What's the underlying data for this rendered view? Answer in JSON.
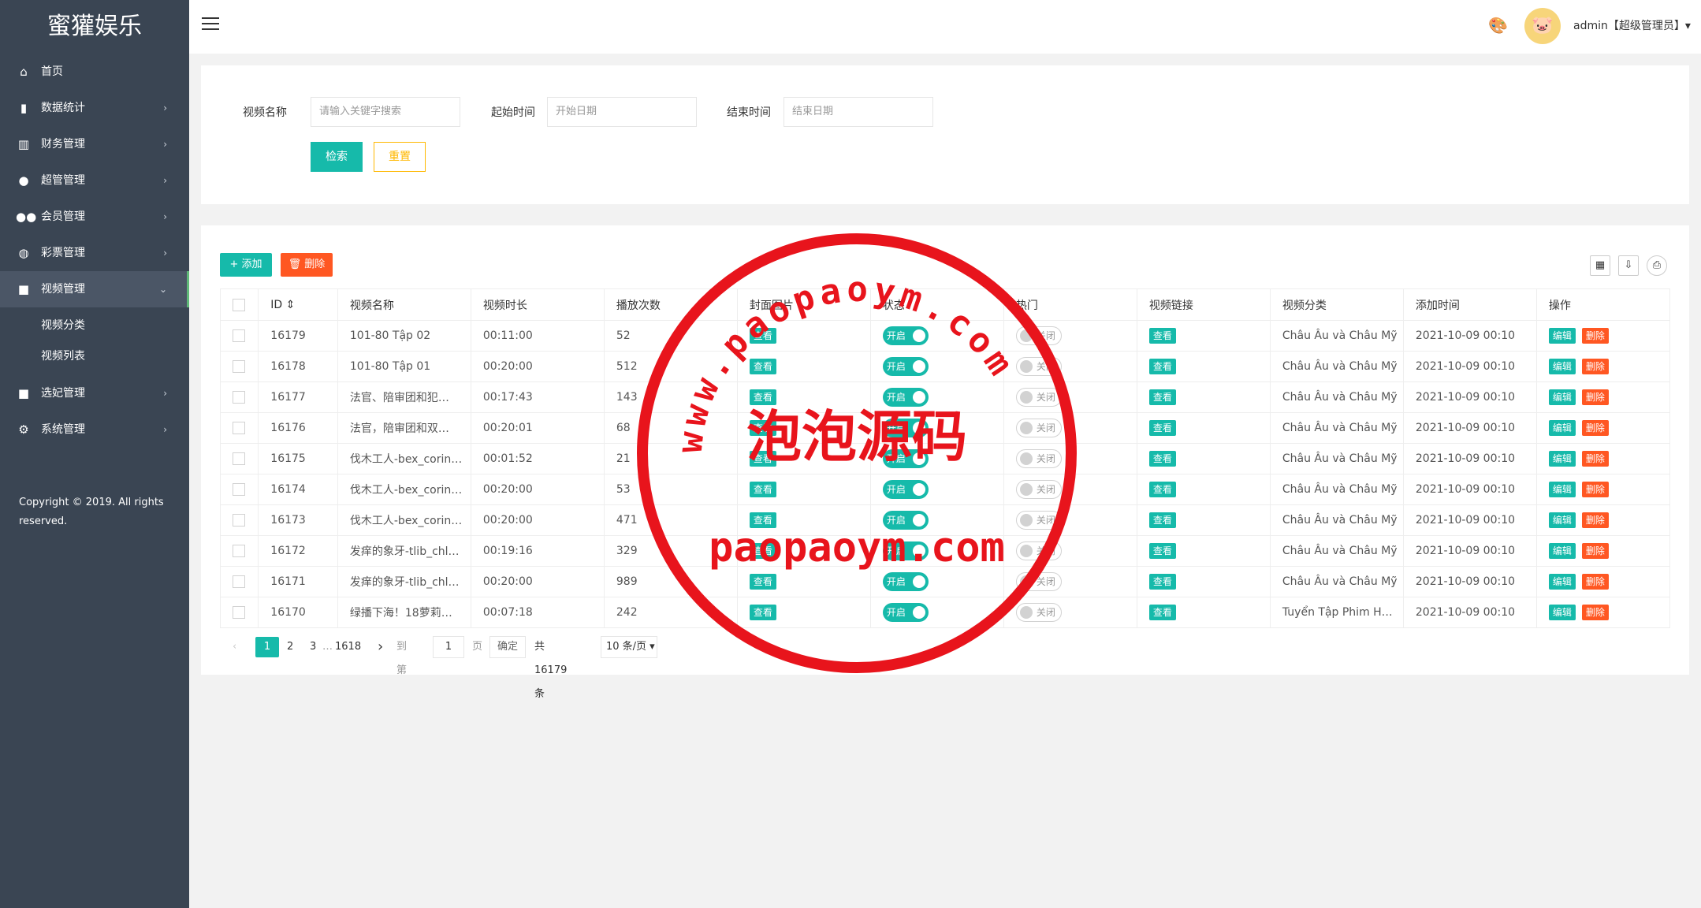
{
  "app": {
    "title": "蜜獾娱乐"
  },
  "sidebar": {
    "items": [
      {
        "label": "首页",
        "icon": "home-icon",
        "glyph": "⌂",
        "arrow": ""
      },
      {
        "label": "数据统计",
        "icon": "bar-chart-icon",
        "glyph": "▮",
        "arrow": "›"
      },
      {
        "label": "财务管理",
        "icon": "bank-icon",
        "glyph": "▥",
        "arrow": "›"
      },
      {
        "label": "超管管理",
        "icon": "user-icon",
        "glyph": "●",
        "arrow": "›"
      },
      {
        "label": "会员管理",
        "icon": "users-icon",
        "glyph": "●●",
        "arrow": "›"
      },
      {
        "label": "彩票管理",
        "icon": "gamepad-icon",
        "glyph": "◍",
        "arrow": "›"
      },
      {
        "label": "视频管理",
        "icon": "video-icon",
        "glyph": "■",
        "arrow": "⌄"
      },
      {
        "label": "选妃管理",
        "icon": "video-icon",
        "glyph": "■",
        "arrow": "›"
      },
      {
        "label": "系统管理",
        "icon": "gear-icon",
        "glyph": "⚙",
        "arrow": "›"
      }
    ],
    "submenu": [
      "视频分类",
      "视频列表"
    ],
    "copyright": "Copyright © 2019. All rights reserved."
  },
  "header": {
    "user": "admin【超级管理员】▾",
    "avatar": "🐷",
    "palette": "🎨"
  },
  "search": {
    "name_label": "视频名称",
    "name_placeholder": "请输入关键字搜索",
    "start_label": "起始时间",
    "start_placeholder": "开始日期",
    "end_label": "结束时间",
    "end_placeholder": "结束日期",
    "search_btn": "检索",
    "reset_btn": "重置"
  },
  "toolbar": {
    "add": "+ 添加",
    "delete": "🗑 删除",
    "icons": [
      "▦",
      "⇩",
      "⎙"
    ]
  },
  "table": {
    "headers": [
      "",
      "ID ⇕",
      "视频名称",
      "视频时长",
      "播放次数",
      "封面图片",
      "状态",
      "热门",
      "视频链接",
      "视频分类",
      "添加时间",
      "操作"
    ],
    "view_label": "查看",
    "on_label": "开启",
    "off_label": "关闭",
    "edit_label": "编辑",
    "del_label": "删除",
    "rows": [
      {
        "id": "16179",
        "name": "101-80 Tập 02",
        "duration": "00:11:00",
        "plays": "52",
        "category": "Châu Âu và Châu Mỹ",
        "time": "2021-10-09 00:10"
      },
      {
        "id": "16178",
        "name": "101-80 Tập 01",
        "duration": "00:20:00",
        "plays": "512",
        "category": "Châu Âu và Châu Mỹ",
        "time": "2021-10-09 00:10"
      },
      {
        "id": "16177",
        "name": "法官、陪审团和犯…",
        "duration": "00:17:43",
        "plays": "143",
        "category": "Châu Âu và Châu Mỹ",
        "time": "2021-10-09 00:10"
      },
      {
        "id": "16176",
        "name": "法官，陪审团和双…",
        "duration": "00:20:01",
        "plays": "68",
        "category": "Châu Âu và Châu Mỹ",
        "time": "2021-10-09 00:10"
      },
      {
        "id": "16175",
        "name": "伐木工人-bex_corin…",
        "duration": "00:01:52",
        "plays": "21",
        "category": "Châu Âu và Châu Mỹ",
        "time": "2021-10-09 00:10"
      },
      {
        "id": "16174",
        "name": "伐木工人-bex_corin…",
        "duration": "00:20:00",
        "plays": "53",
        "category": "Châu Âu và Châu Mỹ",
        "time": "2021-10-09 00:10"
      },
      {
        "id": "16173",
        "name": "伐木工人-bex_corin…",
        "duration": "00:20:00",
        "plays": "471",
        "category": "Châu Âu và Châu Mỹ",
        "time": "2021-10-09 00:10"
      },
      {
        "id": "16172",
        "name": "发痒的象牙-tlib_chl…",
        "duration": "00:19:16",
        "plays": "329",
        "category": "Châu Âu và Châu Mỹ",
        "time": "2021-10-09 00:10"
      },
      {
        "id": "16171",
        "name": "发痒的象牙-tlib_chl…",
        "duration": "00:20:00",
        "plays": "989",
        "category": "Châu Âu và Châu Mỹ",
        "time": "2021-10-09 00:10"
      },
      {
        "id": "16170",
        "name": "绿播下海！18萝莉…",
        "duration": "00:07:18",
        "plays": "242",
        "category": "Tuyển Tập Phim H…",
        "time": "2021-10-09 00:10"
      }
    ]
  },
  "pager": {
    "prev": "‹",
    "current": "1",
    "p2": "2",
    "p3": "3",
    "ellipsis": "…",
    "last": "1618",
    "next": "›",
    "goto": "到第",
    "page_value": "1",
    "page_unit": "页",
    "confirm": "确定",
    "total": "共 16179 条",
    "size": "10 条/页 ▾"
  },
  "stamp": {
    "top_text": "www.paopaoym.com",
    "middle_text": "泡泡源码",
    "bottom_text": "paopaoym.com",
    "color": "#e8141c"
  }
}
